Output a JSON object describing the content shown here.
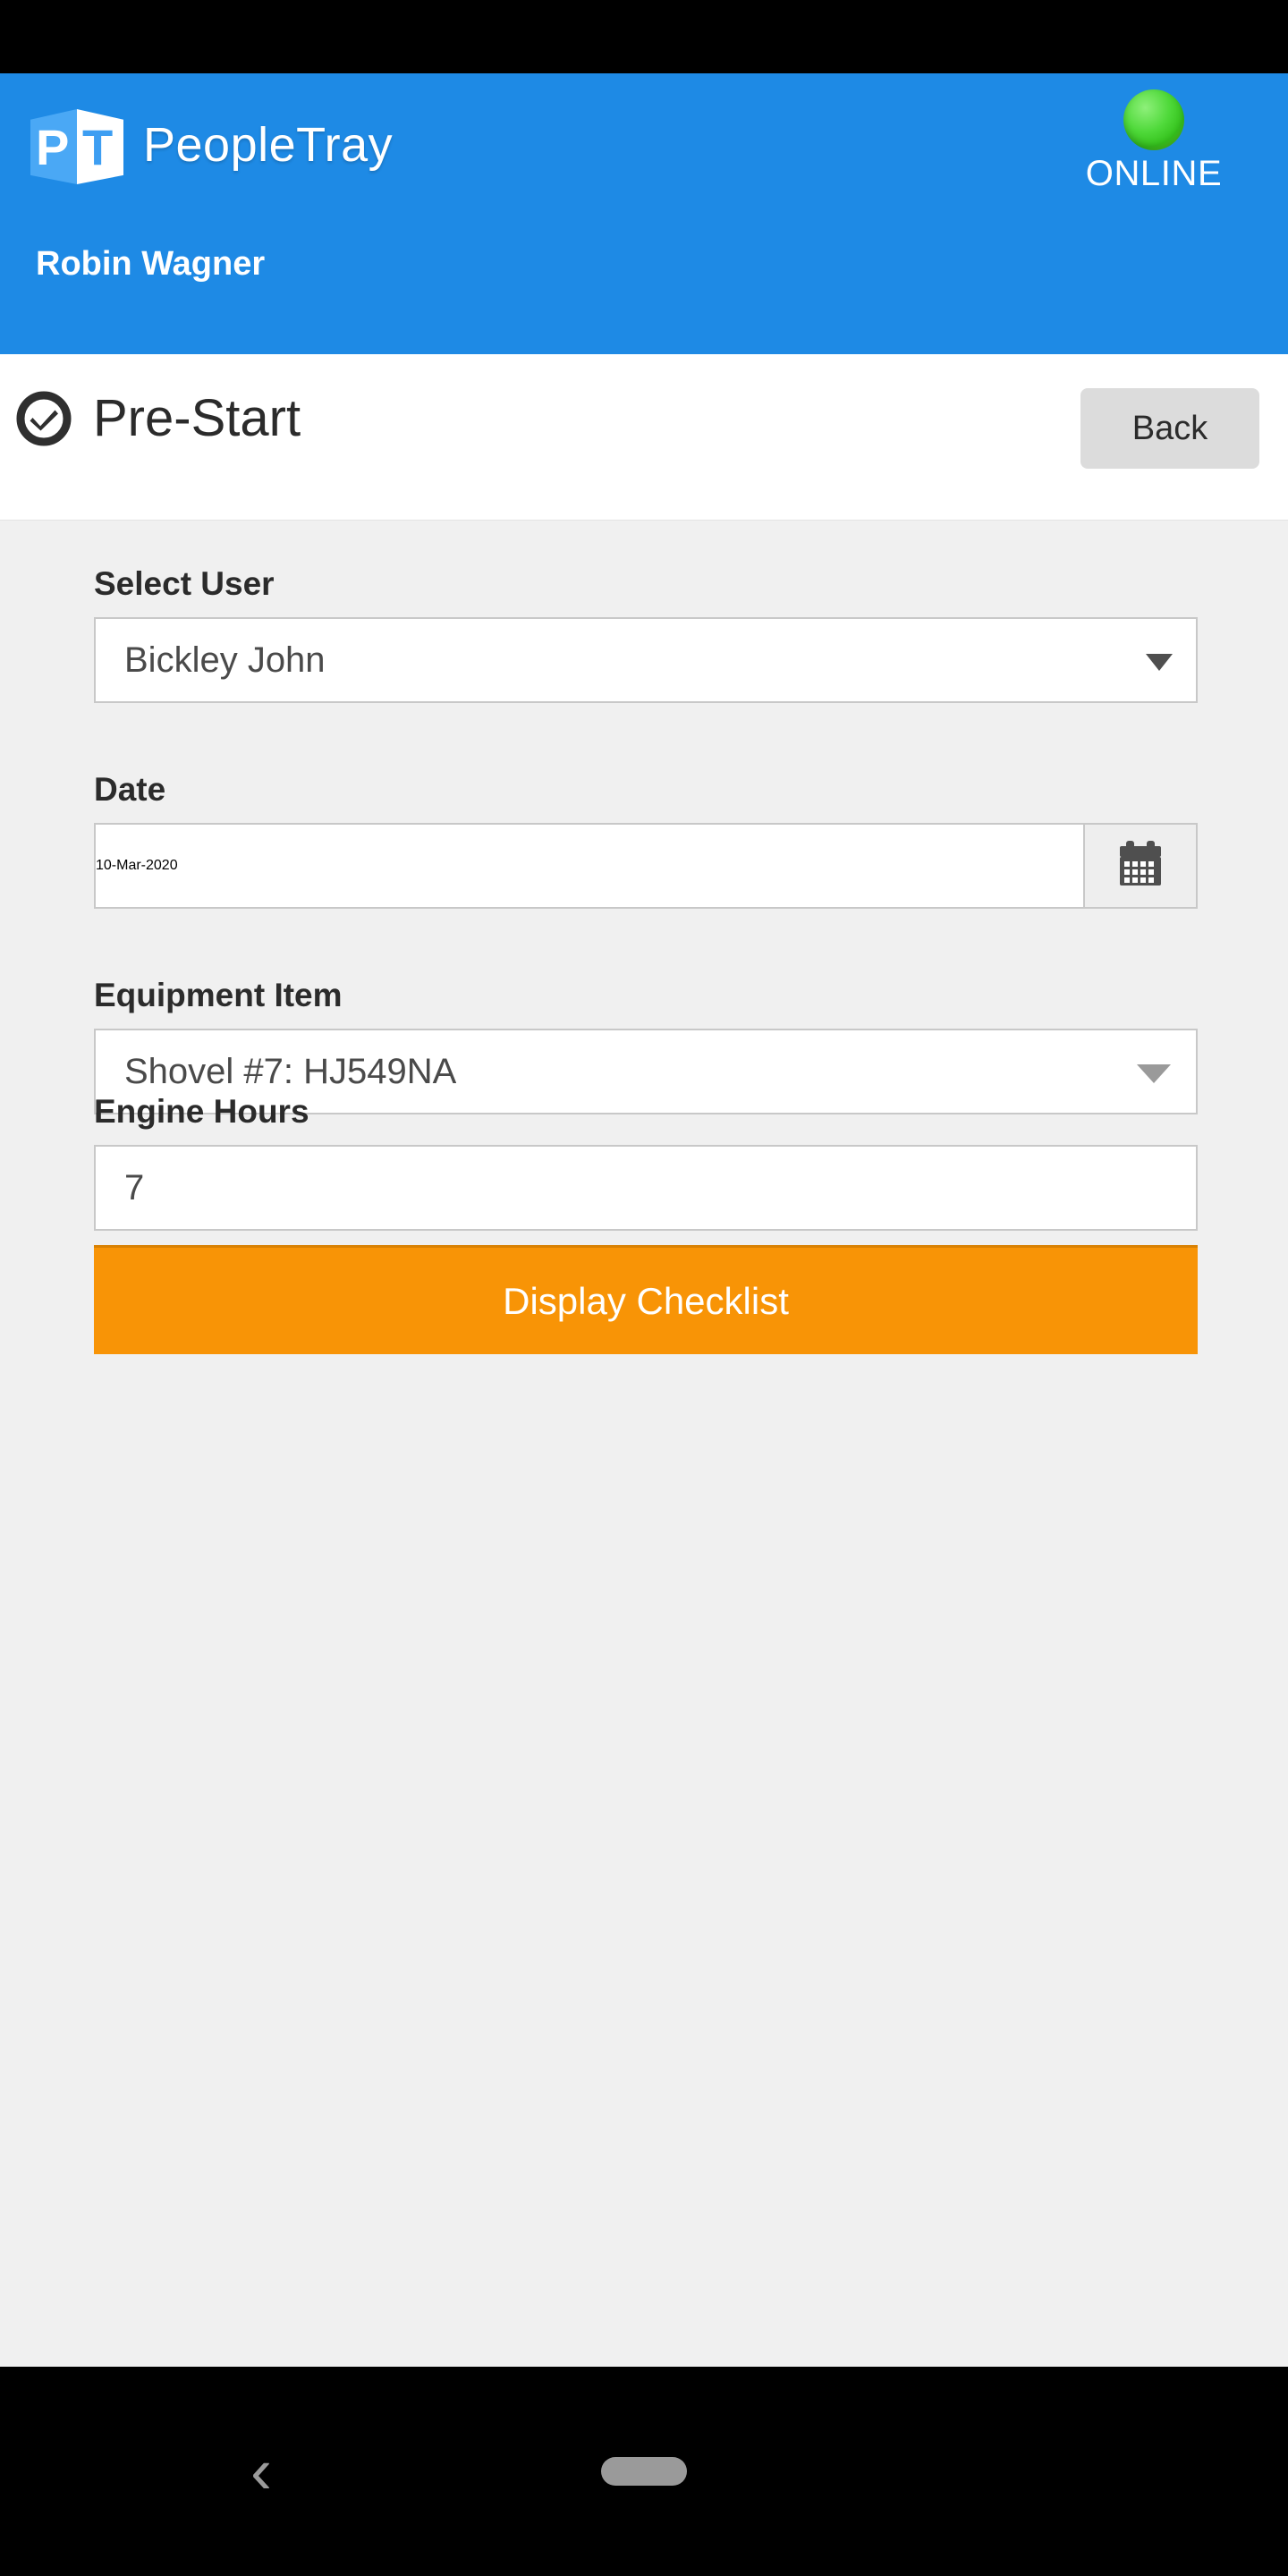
{
  "statusbar": {
    "background": "#000000"
  },
  "header": {
    "background": "#1e8ae5",
    "logo": {
      "letter_p": "P",
      "letter_t": "T",
      "name": "logo-pt"
    },
    "brand": "PeopleTray",
    "connection": {
      "label": "ONLINE",
      "indicator_color": "#4fd93a",
      "state": "online"
    },
    "user": "Robin Wagner"
  },
  "titlebar": {
    "icon": "check-circle-icon",
    "title": "Pre-Start",
    "back_label": "Back"
  },
  "form": {
    "fields": [
      {
        "key": "select_user",
        "label": "Select User",
        "value": "Bickley John",
        "type": "select",
        "icon": "chevron-down-icon"
      },
      {
        "key": "date",
        "label": "Date",
        "value": "10-Mar-2020",
        "type": "date",
        "icon": "calendar-icon"
      },
      {
        "key": "equipment_item",
        "label": "Equipment Item",
        "value": "Shovel #7: HJ549NA",
        "type": "select",
        "icon": "chevron-down-icon"
      },
      {
        "key": "engine_hours",
        "label": "Engine Hours",
        "value": "7",
        "type": "number",
        "placeholder": "Engine Hours"
      }
    ],
    "submit": {
      "label": "Display Checklist",
      "color": "#f89406"
    }
  },
  "navbar": {
    "back_icon": "‹",
    "home_icon": "home-pill-icon"
  }
}
